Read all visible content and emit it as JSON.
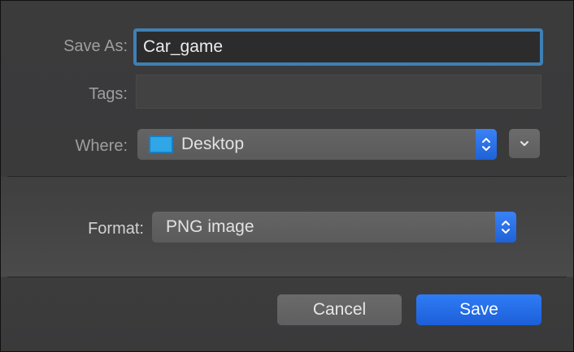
{
  "dialog": {
    "save_as_label": "Save As:",
    "save_as_value": "Car_game",
    "tags_label": "Tags:",
    "tags_value": "",
    "where_label": "Where:",
    "where_value": "Desktop",
    "where_icon": "desktop-folder-icon",
    "expand_icon": "chevron-down-icon",
    "format_label": "Format:",
    "format_value": "PNG image",
    "cancel_label": "Cancel",
    "save_label": "Save"
  },
  "colors": {
    "accent": "#2f7cf6",
    "focus_ring": "#3f80b3",
    "folder": "#2fa6e6"
  }
}
